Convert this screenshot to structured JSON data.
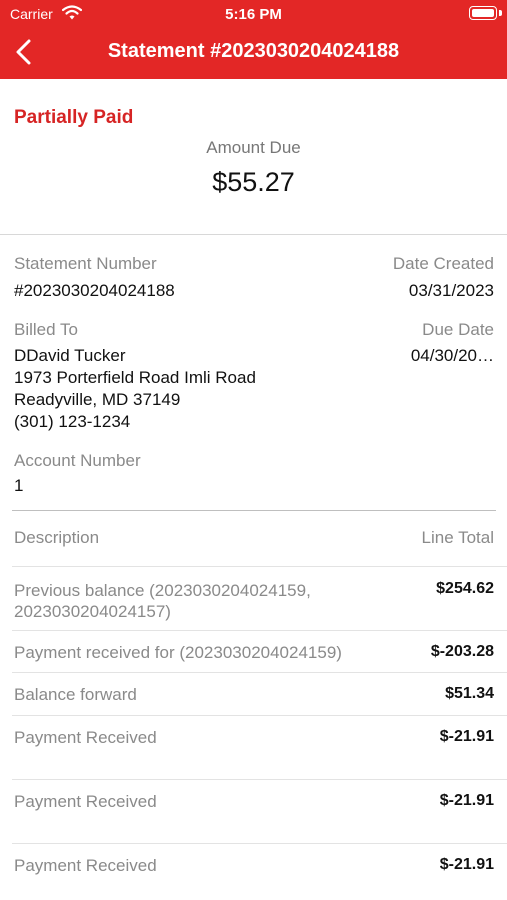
{
  "status_bar": {
    "carrier": "Carrier",
    "time": "5:16 PM"
  },
  "nav": {
    "back_icon": "chevron-left-icon",
    "title": "Statement #2023030204024188"
  },
  "colors": {
    "brand": "#e32726",
    "status": "#d62424"
  },
  "summary": {
    "status": "Partially Paid",
    "amount_due_label": "Amount Due",
    "amount_due": "$55.27"
  },
  "details": {
    "statement_number_label": "Statement Number",
    "statement_number": "#2023030204024188",
    "date_created_label": "Date Created",
    "date_created": "03/31/2023",
    "billed_to_label": "Billed To",
    "billed_to": [
      "DDavid Tucker",
      "1973 Porterfield Road Imli Road",
      "Readyville, MD 37149",
      "(301) 123-1234"
    ],
    "due_date_label": "Due Date",
    "due_date": "04/30/20…",
    "account_number_label": "Account Number",
    "account_number": "1"
  },
  "lines": {
    "header_description": "Description",
    "header_total": "Line Total",
    "items": [
      {
        "description": "Previous balance (2023030204024159, 2023030204024157)",
        "total": "$254.62"
      },
      {
        "description": "Payment received for (2023030204024159)",
        "total": "$-203.28"
      },
      {
        "description": "Balance forward",
        "total": "$51.34"
      },
      {
        "description": "Payment Received",
        "total": "$-21.91"
      },
      {
        "description": "Payment Received",
        "total": "$-21.91"
      },
      {
        "description": "Payment Received",
        "total": "$-21.91"
      }
    ]
  }
}
